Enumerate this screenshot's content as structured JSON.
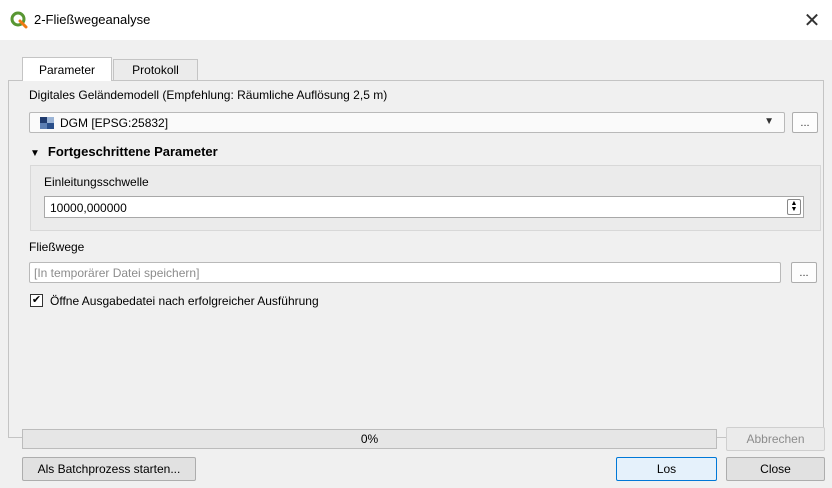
{
  "window": {
    "title": "2-Fließwegeanalyse",
    "close_glyph": "✕",
    "icon": "qgis-icon",
    "accent_color": "#589632"
  },
  "tabs": [
    {
      "label": "Parameter",
      "active": true
    },
    {
      "label": "Protokoll",
      "active": false
    }
  ],
  "dem": {
    "label": "Digitales Geländemodell (Empfehlung: Räumliche Auflösung 2,5 m)",
    "value": "DGM [EPSG:25832]",
    "icon": "raster-layer-icon",
    "browse_label": "..."
  },
  "advanced": {
    "header": "Fortgeschrittene Parameter",
    "threshold_label": "Einleitungsschwelle",
    "threshold_value": "10000,000000"
  },
  "output": {
    "label": "Fließwege",
    "placeholder": "[In temporärer Datei speichern]",
    "browse_label": "..."
  },
  "open_output": {
    "checked": true,
    "label": "Öffne Ausgabedatei nach erfolgreicher Ausführung"
  },
  "progress": {
    "value": 0,
    "text": "0%"
  },
  "buttons": {
    "cancel": "Abbrechen",
    "batch": "Als Batchprozess starten...",
    "run": "Los",
    "close": "Close"
  }
}
